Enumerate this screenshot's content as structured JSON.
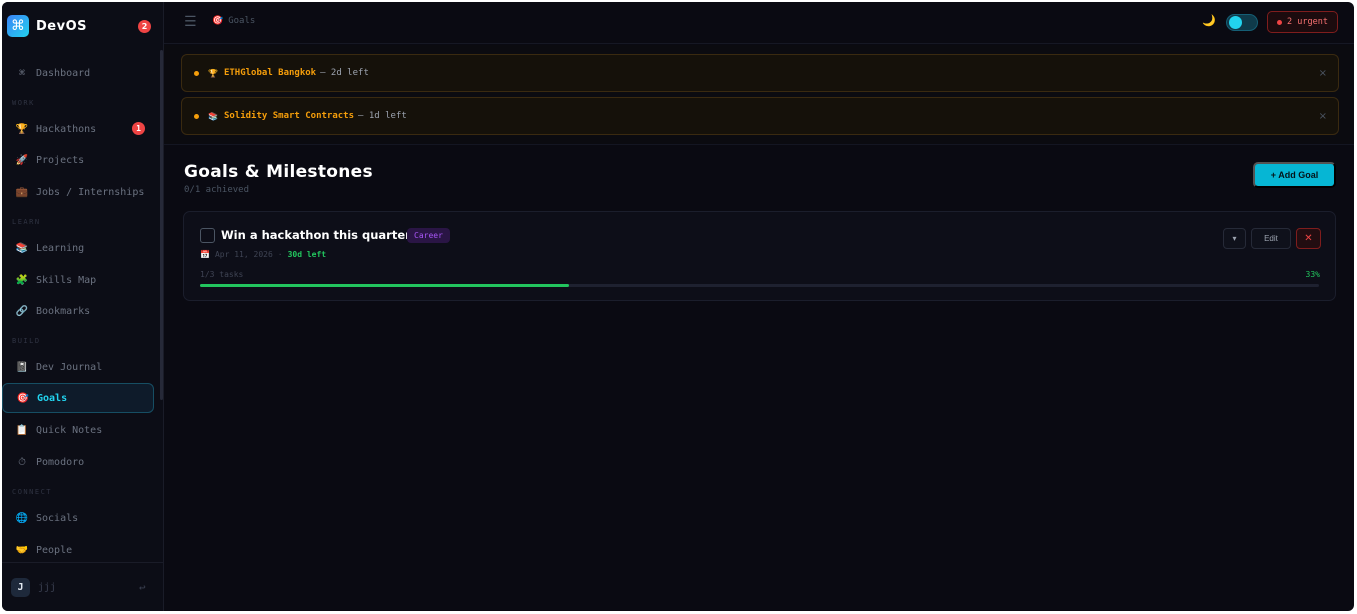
{
  "brand": {
    "logo": "⌘",
    "name": "DevOS",
    "badge": "2"
  },
  "nav": {
    "dashboard": {
      "icon": "⌘",
      "label": "Dashboard"
    },
    "sections": {
      "work": "WORK",
      "learn": "LEARN",
      "build": "BUILD",
      "connect": "CONNECT"
    },
    "hackathons": {
      "icon": "🏆",
      "label": "Hackathons",
      "badge": "1"
    },
    "projects": {
      "icon": "🚀",
      "label": "Projects"
    },
    "jobs": {
      "icon": "💼",
      "label": "Jobs / Internships"
    },
    "learning": {
      "icon": "📚",
      "label": "Learning"
    },
    "skills": {
      "icon": "🧩",
      "label": "Skills Map"
    },
    "bookmarks": {
      "icon": "🔗",
      "label": "Bookmarks"
    },
    "journal": {
      "icon": "📓",
      "label": "Dev Journal"
    },
    "goals": {
      "icon": "🎯",
      "label": "Goals"
    },
    "notes": {
      "icon": "📋",
      "label": "Quick Notes"
    },
    "pomodoro": {
      "icon": "⏱",
      "label": "Pomodoro"
    },
    "socials": {
      "icon": "🌐",
      "label": "Socials"
    },
    "people": {
      "icon": "🤝",
      "label": "People"
    }
  },
  "user": {
    "initial": "J",
    "name": "jjj",
    "logout_icon": "↩"
  },
  "topbar": {
    "menu_icon": "☰",
    "breadcrumb_icon": "🎯",
    "breadcrumb": "Goals",
    "theme_icon": "🌙",
    "urgent_label": "2 urgent"
  },
  "alerts": [
    {
      "icon": "🏆",
      "title": "ETHGlobal Bangkok",
      "rest": "— 2d left",
      "close": "×"
    },
    {
      "icon": "📚",
      "title": "Solidity Smart Contracts",
      "rest": "— 1d left",
      "close": "×"
    }
  ],
  "page": {
    "title": "Goals & Milestones",
    "subtitle": "0/1 achieved",
    "add_button": "+ Add Goal"
  },
  "goal": {
    "title": "Win a hackathon this quarter",
    "tag": "Career",
    "date_icon": "📅",
    "date": "Apr 11, 2026",
    "separator": "·",
    "time_left": "30d left",
    "expand_icon": "▾",
    "edit_label": "Edit",
    "delete_icon": "✕",
    "tasks": "1/3 tasks",
    "percent": "33%",
    "progress": 0.33
  },
  "colors": {
    "accent": "#22d3ee",
    "success": "#22c55e",
    "danger": "#ef4444",
    "warning": "#f59e0b",
    "tag": "#a855f7"
  }
}
